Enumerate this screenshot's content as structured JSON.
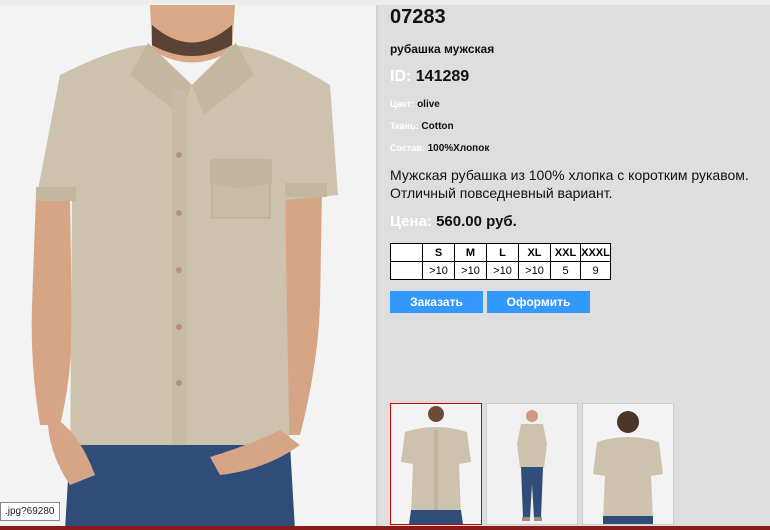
{
  "product": {
    "code": "07283",
    "name": "рубашка мужская",
    "id_label": "ID:",
    "id_value": "141289",
    "attributes": [
      {
        "label": "Цвет:",
        "value": "olive"
      },
      {
        "label": "Ткань:",
        "value": "Cotton"
      },
      {
        "label": "Состав:",
        "value": "100%Хлопок"
      }
    ],
    "description": "Мужская рубашка из 100% хлопка с коротким рукавом. Отличный повседневный вариант.",
    "price_label": "Цена:",
    "price_value": "560.00 руб."
  },
  "sizes": {
    "headers": [
      "",
      "S",
      "M",
      "L",
      "XL",
      "XXL",
      "XXXL"
    ],
    "quantities": [
      "",
      ">10",
      ">10",
      ">10",
      ">10",
      "5",
      "9"
    ]
  },
  "buttons": {
    "order": "Заказать",
    "checkout": "Оформить"
  },
  "colors": {
    "button": "#3399ff",
    "selected_thumb_border": "#cc0000",
    "shirt": "#cdc2ad",
    "jeans": "#2f4d78"
  },
  "status_tooltip": ".jpg?69280"
}
